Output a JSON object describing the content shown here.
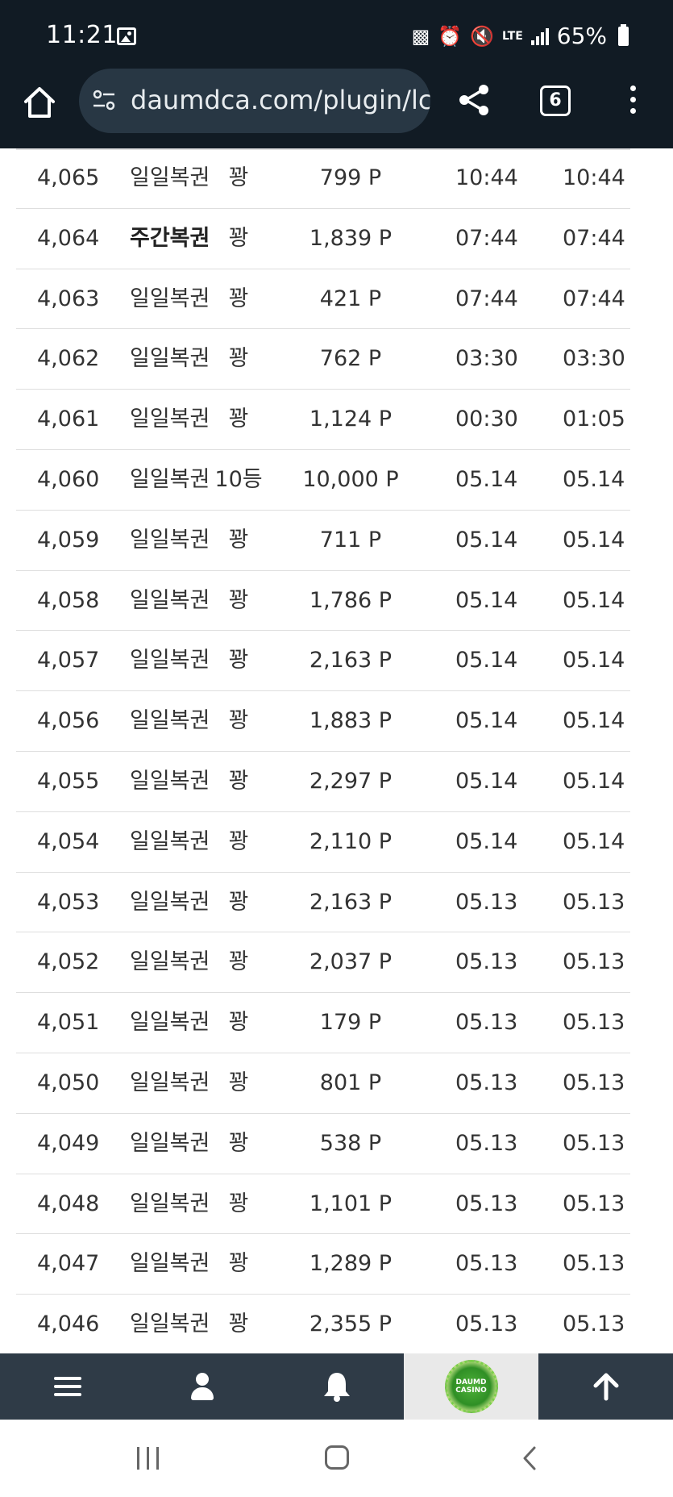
{
  "status_bar": {
    "time": "11:21",
    "battery": "65%",
    "network": "LTE",
    "icons": [
      "gallery-icon",
      "assistant-icon",
      "alarm-icon",
      "mute-icon",
      "lte-icon",
      "signal-icon",
      "battery-icon"
    ]
  },
  "browser": {
    "url": "daumdca.com/plugin/lc",
    "tab_count": "6",
    "icons": [
      "home-icon",
      "site-settings-icon",
      "share-icon",
      "tabs-icon",
      "more-vert-icon"
    ]
  },
  "rows": [
    {
      "no": "4,065",
      "type": "일일복권",
      "rank": "꽝",
      "point": "799 P",
      "date1": "10:44",
      "date2": "10:44"
    },
    {
      "no": "4,064",
      "type": "주간복권",
      "rank": "꽝",
      "point": "1,839 P",
      "date1": "07:44",
      "date2": "07:44"
    },
    {
      "no": "4,063",
      "type": "일일복권",
      "rank": "꽝",
      "point": "421 P",
      "date1": "07:44",
      "date2": "07:44"
    },
    {
      "no": "4,062",
      "type": "일일복권",
      "rank": "꽝",
      "point": "762 P",
      "date1": "03:30",
      "date2": "03:30"
    },
    {
      "no": "4,061",
      "type": "일일복권",
      "rank": "꽝",
      "point": "1,124 P",
      "date1": "00:30",
      "date2": "01:05"
    },
    {
      "no": "4,060",
      "type": "일일복권",
      "rank": "10등",
      "point": "10,000 P",
      "date1": "05.14",
      "date2": "05.14"
    },
    {
      "no": "4,059",
      "type": "일일복권",
      "rank": "꽝",
      "point": "711 P",
      "date1": "05.14",
      "date2": "05.14"
    },
    {
      "no": "4,058",
      "type": "일일복권",
      "rank": "꽝",
      "point": "1,786 P",
      "date1": "05.14",
      "date2": "05.14"
    },
    {
      "no": "4,057",
      "type": "일일복권",
      "rank": "꽝",
      "point": "2,163 P",
      "date1": "05.14",
      "date2": "05.14"
    },
    {
      "no": "4,056",
      "type": "일일복권",
      "rank": "꽝",
      "point": "1,883 P",
      "date1": "05.14",
      "date2": "05.14"
    },
    {
      "no": "4,055",
      "type": "일일복권",
      "rank": "꽝",
      "point": "2,297 P",
      "date1": "05.14",
      "date2": "05.14"
    },
    {
      "no": "4,054",
      "type": "일일복권",
      "rank": "꽝",
      "point": "2,110 P",
      "date1": "05.14",
      "date2": "05.14"
    },
    {
      "no": "4,053",
      "type": "일일복권",
      "rank": "꽝",
      "point": "2,163 P",
      "date1": "05.13",
      "date2": "05.13"
    },
    {
      "no": "4,052",
      "type": "일일복권",
      "rank": "꽝",
      "point": "2,037 P",
      "date1": "05.13",
      "date2": "05.13"
    },
    {
      "no": "4,051",
      "type": "일일복권",
      "rank": "꽝",
      "point": "179 P",
      "date1": "05.13",
      "date2": "05.13"
    },
    {
      "no": "4,050",
      "type": "일일복권",
      "rank": "꽝",
      "point": "801 P",
      "date1": "05.13",
      "date2": "05.13"
    },
    {
      "no": "4,049",
      "type": "일일복권",
      "rank": "꽝",
      "point": "538 P",
      "date1": "05.13",
      "date2": "05.13"
    },
    {
      "no": "4,048",
      "type": "일일복권",
      "rank": "꽝",
      "point": "1,101 P",
      "date1": "05.13",
      "date2": "05.13"
    },
    {
      "no": "4,047",
      "type": "일일복권",
      "rank": "꽝",
      "point": "1,289 P",
      "date1": "05.13",
      "date2": "05.13"
    },
    {
      "no": "4,046",
      "type": "일일복권",
      "rank": "꽝",
      "point": "2,355 P",
      "date1": "05.13",
      "date2": "05.13"
    }
  ],
  "bold_types": [
    "주간복권"
  ],
  "bottom_nav": {
    "logo_text": "DAUMD CASINO",
    "icons": [
      "menu-icon",
      "user-icon",
      "bell-icon",
      "logo",
      "arrow-up-icon"
    ]
  },
  "colors": {
    "status_bg": "#111b24",
    "url_bg": "#283744",
    "nav_bg": "#2f3b47",
    "logo_bg": "#e9e9e9",
    "row_text": "#333333",
    "row_divider": "#dedede"
  }
}
